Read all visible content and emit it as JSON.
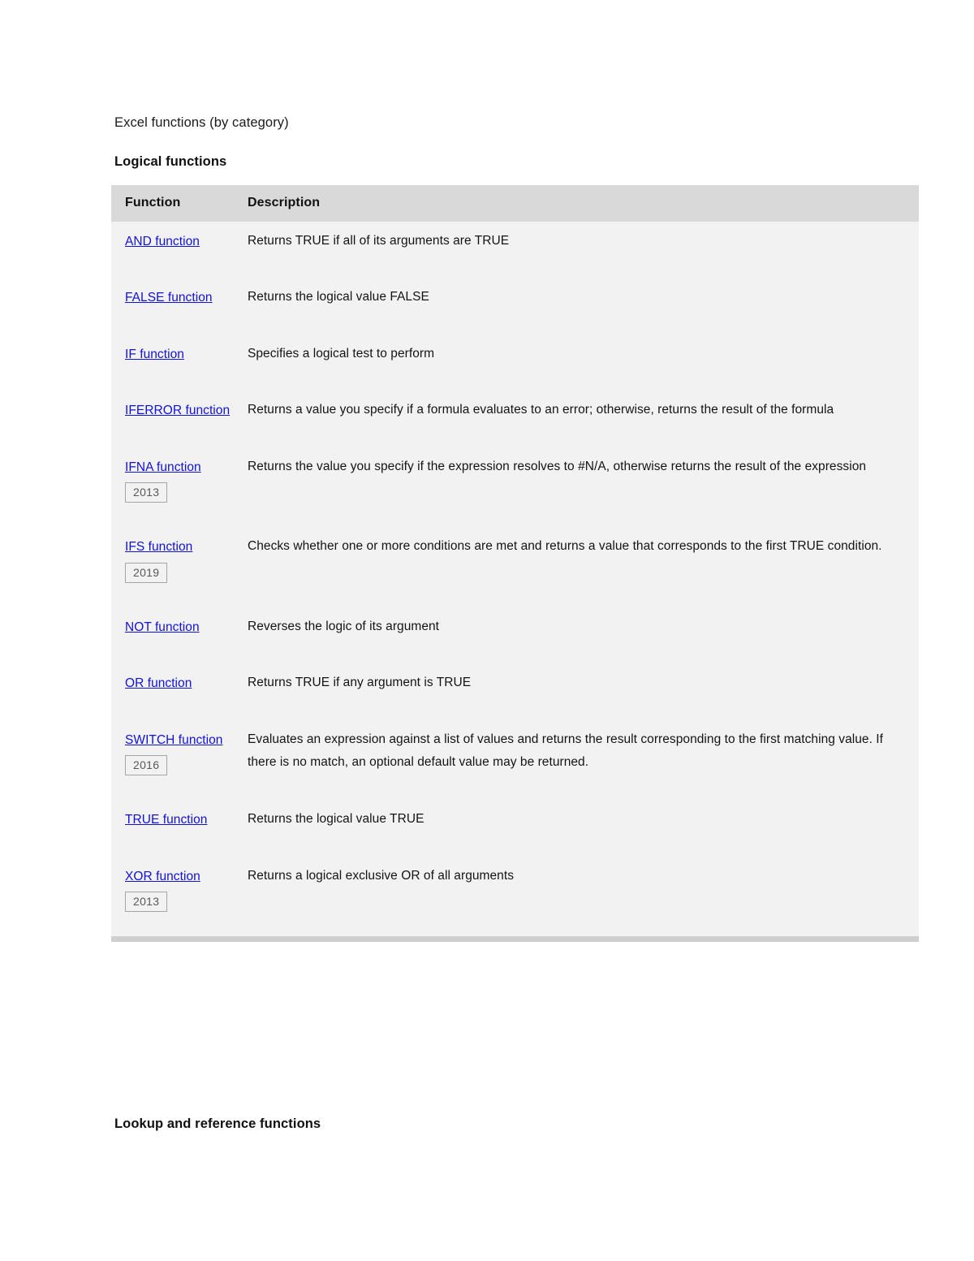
{
  "document": {
    "title": "Excel functions (by category)",
    "section_heading": "Logical functions",
    "bottom_heading": "Lookup and reference functions"
  },
  "table": {
    "columns": {
      "function": "Function",
      "description": "Description"
    },
    "rows": [
      {
        "link": "AND function",
        "badge": "",
        "description": "Returns TRUE if all of its arguments are TRUE"
      },
      {
        "link": "FALSE function",
        "badge": "",
        "description": "Returns the logical value FALSE"
      },
      {
        "link": "IF function",
        "badge": "",
        "description": "Specifies a logical test to perform"
      },
      {
        "link": "IFERROR function",
        "badge": "",
        "description": "Returns a value you specify if a formula evaluates to an error; otherwise, returns the result of the formula"
      },
      {
        "link": "IFNA function",
        "badge": "2013",
        "description": "Returns the value you specify if the expression resolves to #N/A, otherwise returns the result of the expression"
      },
      {
        "link": "IFS function",
        "badge": "2019",
        "description": "Checks whether one or more conditions are met and returns a value that corresponds to the first TRUE condition."
      },
      {
        "link": "NOT function",
        "badge": "",
        "description": "Reverses the logic of its argument"
      },
      {
        "link": "OR function",
        "badge": "",
        "description": "Returns TRUE if any argument is TRUE"
      },
      {
        "link": "SWITCH function",
        "badge": "2016",
        "description": "Evaluates an expression against a list of values and returns the result corresponding to the first matching value. If there is no match, an optional default value may be returned."
      },
      {
        "link": "TRUE function",
        "badge": "",
        "description": "Returns the logical value TRUE"
      },
      {
        "link": "XOR function",
        "badge": "2013",
        "description": "Returns a logical exclusive OR of all arguments"
      }
    ]
  },
  "colors": {
    "link": "#1111dd",
    "header_background": "#d9d9d9",
    "row_background": "#f2f2f2",
    "badge_border": "#a6a6a6",
    "badge_text": "#595959"
  }
}
